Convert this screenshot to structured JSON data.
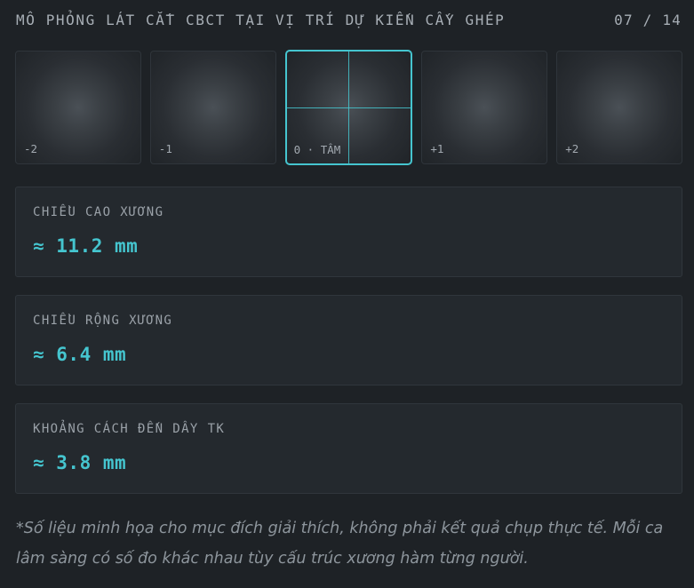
{
  "header": {
    "title": "MÔ PHỎNG LÁT CẮT CBCT TẠI VỊ TRÍ DỰ KIẾN CẤY GHÉP",
    "counter": "07 / 14"
  },
  "slices": [
    {
      "label": "-2"
    },
    {
      "label": "-1"
    },
    {
      "label": "0 · TÂM",
      "active": true
    },
    {
      "label": "+1"
    },
    {
      "label": "+2"
    }
  ],
  "metrics": [
    {
      "label": "CHIỀU CAO XƯƠNG",
      "value": "≈ 11.2 mm"
    },
    {
      "label": "CHIỀU RỘNG XƯƠNG",
      "value": "≈ 6.4 mm"
    },
    {
      "label": "KHOẢNG CÁCH ĐẾN DÂY TK",
      "value": "≈ 3.8 mm"
    }
  ],
  "note": "*Số liệu minh họa cho mục đích giải thích, không phải kết quả chụp thực tế. Mỗi ca lâm sàng có số đo khác nhau tùy cấu trúc xương hàm từng người.",
  "colors": {
    "accent": "#45c5cf",
    "background": "#1e2226",
    "card": "#24292e"
  }
}
